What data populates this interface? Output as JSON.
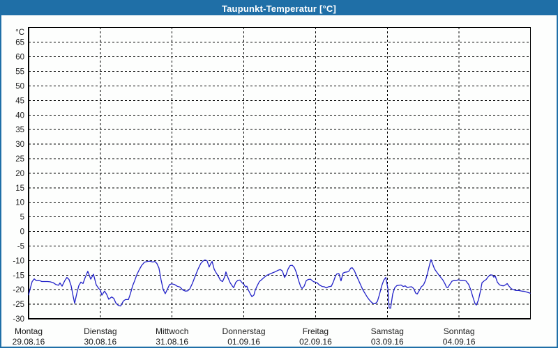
{
  "window": {
    "title": "Taupunkt-Temperatur [°C]"
  },
  "colors": {
    "titlebar_bg": "#1f6fa7",
    "frame_border": "#1f6fa7",
    "background": "#fdfefd",
    "grid": "#000000",
    "axis": "#000000",
    "label_text": "#1a1a1a",
    "line": "#2121c8"
  },
  "chart_data": {
    "type": "line",
    "title": "Taupunkt-Temperatur [°C]",
    "y_unit": "°C",
    "ylabel": "Taupunkt-Temperatur",
    "xlabel": "",
    "grid": true,
    "legend": "none",
    "ylim": [
      -30,
      70.2
    ],
    "y_ticks": [
      65,
      60,
      55,
      50,
      45,
      40,
      35,
      30,
      25,
      20,
      15,
      10,
      5,
      0,
      -5,
      -10,
      -15,
      -20,
      -25,
      -30
    ],
    "x_hours_total": 168,
    "x_days": [
      {
        "name": "Montag",
        "date": "29.08.16"
      },
      {
        "name": "Dienstag",
        "date": "30.08.16"
      },
      {
        "name": "Mittwoch",
        "date": "31.08.16"
      },
      {
        "name": "Donnerstag",
        "date": "01.09.16"
      },
      {
        "name": "Freitag",
        "date": "02.09.16"
      },
      {
        "name": "Samstag",
        "date": "03.09.16"
      },
      {
        "name": "Sonntag",
        "date": "04.09.16"
      }
    ],
    "series": [
      {
        "name": "Taupunkt",
        "color": "#2121c8",
        "points": [
          [
            0,
            -21.8
          ],
          [
            0.5,
            -19.8
          ],
          [
            1.2,
            -17.2
          ],
          [
            1.9,
            -16.3
          ],
          [
            2.6,
            -16.9
          ],
          [
            3.5,
            -16.8
          ],
          [
            4.4,
            -17.2
          ],
          [
            5.4,
            -17.2
          ],
          [
            6.3,
            -17.2
          ],
          [
            7.2,
            -17.3
          ],
          [
            8.2,
            -17.6
          ],
          [
            9.1,
            -18.2
          ],
          [
            10,
            -18.5
          ],
          [
            10.5,
            -17.7
          ],
          [
            11.2,
            -18.8
          ],
          [
            12.1,
            -16.9
          ],
          [
            12.8,
            -15.8
          ],
          [
            13.5,
            -16.5
          ],
          [
            14.2,
            -18.6
          ],
          [
            14.9,
            -22.3
          ],
          [
            15.4,
            -24.7
          ],
          [
            16.1,
            -21.4
          ],
          [
            16.8,
            -18.6
          ],
          [
            17.5,
            -17.4
          ],
          [
            18.2,
            -17.9
          ],
          [
            18.9,
            -15.9
          ],
          [
            19.8,
            -13.7
          ],
          [
            20.8,
            -16.4
          ],
          [
            21.7,
            -14.7
          ],
          [
            22.6,
            -18.3
          ],
          [
            23.3,
            -19.4
          ],
          [
            24,
            -20.2
          ],
          [
            24.5,
            -21.9
          ],
          [
            25.4,
            -20.5
          ],
          [
            26.1,
            -21.6
          ],
          [
            26.8,
            -23.3
          ],
          [
            27.8,
            -22.5
          ],
          [
            28.5,
            -23
          ],
          [
            29.2,
            -24.6
          ],
          [
            30.1,
            -25.5
          ],
          [
            30.8,
            -25.6
          ],
          [
            31.7,
            -23.9
          ],
          [
            32.4,
            -23.4
          ],
          [
            33.4,
            -23.4
          ],
          [
            34.1,
            -21.3
          ],
          [
            34.8,
            -18.7
          ],
          [
            35.5,
            -16.9
          ],
          [
            36.2,
            -14.9
          ],
          [
            36.9,
            -13.4
          ],
          [
            37.8,
            -11.7
          ],
          [
            38.7,
            -10.6
          ],
          [
            39.7,
            -10.3
          ],
          [
            40.6,
            -10.2
          ],
          [
            41.5,
            -10.5
          ],
          [
            42.2,
            -10.3
          ],
          [
            42.9,
            -11
          ],
          [
            43.6,
            -12.6
          ],
          [
            44.3,
            -16.6
          ],
          [
            45,
            -19.9
          ],
          [
            45.7,
            -21.4
          ],
          [
            46.4,
            -19.9
          ],
          [
            47.1,
            -18.3
          ],
          [
            47.8,
            -18
          ],
          [
            48.8,
            -18.2
          ],
          [
            49.7,
            -18.8
          ],
          [
            50.6,
            -19.1
          ],
          [
            51.6,
            -20.1
          ],
          [
            52.5,
            -20.5
          ],
          [
            53.2,
            -20.4
          ],
          [
            53.9,
            -19.8
          ],
          [
            54.8,
            -17.8
          ],
          [
            55.8,
            -15.2
          ],
          [
            56.7,
            -12.9
          ],
          [
            57.6,
            -11
          ],
          [
            58.3,
            -10.2
          ],
          [
            59,
            -9.8
          ],
          [
            59.7,
            -10.1
          ],
          [
            60.4,
            -12.2
          ],
          [
            60.9,
            -11.1
          ],
          [
            61.4,
            -10.3
          ],
          [
            62.1,
            -13
          ],
          [
            62.8,
            -14.3
          ],
          [
            63.5,
            -15.4
          ],
          [
            64.2,
            -16.8
          ],
          [
            64.9,
            -17.2
          ],
          [
            65.6,
            -15.6
          ],
          [
            66,
            -13.9
          ],
          [
            66.7,
            -15.9
          ],
          [
            67.4,
            -17.6
          ],
          [
            68.1,
            -18.7
          ],
          [
            68.6,
            -19.3
          ],
          [
            69.3,
            -17.5
          ],
          [
            70,
            -16.8
          ],
          [
            70.7,
            -16.7
          ],
          [
            71.4,
            -17.6
          ],
          [
            72.1,
            -18.3
          ],
          [
            72.6,
            -19.1
          ],
          [
            73,
            -18.8
          ],
          [
            73.5,
            -20.1
          ],
          [
            74.2,
            -21.5
          ],
          [
            74.7,
            -22.4
          ],
          [
            75.4,
            -21.8
          ],
          [
            75.8,
            -20.2
          ],
          [
            76.5,
            -18.6
          ],
          [
            77.2,
            -17.2
          ],
          [
            77.9,
            -16.6
          ],
          [
            78.9,
            -15.7
          ],
          [
            79.8,
            -15
          ],
          [
            80.7,
            -14.6
          ],
          [
            81.7,
            -14.2
          ],
          [
            82.6,
            -13.8
          ],
          [
            83.5,
            -13.3
          ],
          [
            84.2,
            -13.1
          ],
          [
            84.9,
            -13.6
          ],
          [
            85.6,
            -15.8
          ],
          [
            86.1,
            -15
          ],
          [
            86.8,
            -12.9
          ],
          [
            87.5,
            -11.7
          ],
          [
            88.2,
            -11.6
          ],
          [
            88.9,
            -12.4
          ],
          [
            89.6,
            -14.2
          ],
          [
            90.3,
            -16.8
          ],
          [
            91,
            -18.9
          ],
          [
            91.5,
            -19.6
          ],
          [
            92.2,
            -18.8
          ],
          [
            92.9,
            -16.9
          ],
          [
            93.6,
            -16.5
          ],
          [
            94.3,
            -16.4
          ],
          [
            95,
            -17
          ],
          [
            95.4,
            -17.3
          ],
          [
            95.9,
            -17.4
          ],
          [
            96.6,
            -17.7
          ],
          [
            97.3,
            -18.4
          ],
          [
            98.2,
            -18.9
          ],
          [
            98.9,
            -19
          ],
          [
            99.6,
            -19.4
          ],
          [
            100.3,
            -19
          ],
          [
            101.3,
            -18.8
          ],
          [
            102,
            -17.2
          ],
          [
            102.7,
            -15.2
          ],
          [
            103.1,
            -14.6
          ],
          [
            103.8,
            -14.5
          ],
          [
            104.5,
            -17
          ],
          [
            105.2,
            -14.3
          ],
          [
            105.9,
            -14
          ],
          [
            106.6,
            -13.9
          ],
          [
            107.1,
            -13.7
          ],
          [
            107.8,
            -12.6
          ],
          [
            108.3,
            -12.5
          ],
          [
            109,
            -13.5
          ],
          [
            109.7,
            -15.2
          ],
          [
            110.4,
            -16.8
          ],
          [
            111.1,
            -18.4
          ],
          [
            111.8,
            -20
          ],
          [
            112.5,
            -21.2
          ],
          [
            113.2,
            -22.4
          ],
          [
            113.9,
            -23.4
          ],
          [
            114.6,
            -24.2
          ],
          [
            115.3,
            -24.8
          ],
          [
            116,
            -24.8
          ],
          [
            116.7,
            -24
          ],
          [
            117.4,
            -21.6
          ],
          [
            118.1,
            -18.8
          ],
          [
            118.8,
            -16.8
          ],
          [
            119.5,
            -15.8
          ],
          [
            120.2,
            -19.6
          ],
          [
            120.6,
            -26.3
          ],
          [
            121.1,
            -26.4
          ],
          [
            121.8,
            -21.5
          ],
          [
            122.5,
            -19.3
          ],
          [
            123.2,
            -18.6
          ],
          [
            123.9,
            -18.5
          ],
          [
            124.6,
            -18.4
          ],
          [
            125.3,
            -18.9
          ],
          [
            126,
            -18.7
          ],
          [
            126.7,
            -19.3
          ],
          [
            127.4,
            -19.1
          ],
          [
            128.1,
            -19
          ],
          [
            128.8,
            -19.6
          ],
          [
            129.5,
            -21.2
          ],
          [
            130,
            -21.5
          ],
          [
            130.7,
            -20.3
          ],
          [
            131.4,
            -19
          ],
          [
            132.1,
            -18.4
          ],
          [
            132.8,
            -16.8
          ],
          [
            133.5,
            -14.2
          ],
          [
            134.2,
            -11.2
          ],
          [
            134.6,
            -9.7
          ],
          [
            135.1,
            -11
          ],
          [
            135.8,
            -12.9
          ],
          [
            136.5,
            -13.9
          ],
          [
            137.2,
            -14.9
          ],
          [
            137.9,
            -15.8
          ],
          [
            138.6,
            -16.7
          ],
          [
            139.3,
            -18
          ],
          [
            139.8,
            -19.2
          ],
          [
            140.2,
            -19.3
          ],
          [
            140.9,
            -18.2
          ],
          [
            141.6,
            -17.1
          ],
          [
            142.3,
            -16.8
          ],
          [
            143,
            -16.9
          ],
          [
            143.7,
            -16.6
          ],
          [
            144.4,
            -16.8
          ],
          [
            145.4,
            -16.8
          ],
          [
            146.3,
            -17
          ],
          [
            147.2,
            -18.2
          ],
          [
            147.9,
            -20
          ],
          [
            148.6,
            -22.5
          ],
          [
            149.3,
            -24.7
          ],
          [
            149.8,
            -25.3
          ],
          [
            150.5,
            -23.5
          ],
          [
            151.2,
            -20.3
          ],
          [
            151.7,
            -17.6
          ],
          [
            152.4,
            -17
          ],
          [
            153.1,
            -16.5
          ],
          [
            153.8,
            -15.5
          ],
          [
            154.5,
            -14.9
          ],
          [
            155.2,
            -15
          ],
          [
            155.6,
            -15.7
          ],
          [
            156.1,
            -15.3
          ],
          [
            156.8,
            -17.4
          ],
          [
            157.5,
            -18.3
          ],
          [
            158.2,
            -18.6
          ],
          [
            158.9,
            -18.7
          ],
          [
            159.6,
            -18.3
          ],
          [
            160.1,
            -17.9
          ],
          [
            160.8,
            -18.9
          ],
          [
            161.5,
            -19.7
          ],
          [
            162.2,
            -20
          ],
          [
            163.1,
            -20.3
          ],
          [
            164,
            -20.3
          ],
          [
            165,
            -20.5
          ],
          [
            165.9,
            -20.6
          ],
          [
            166.8,
            -20.9
          ],
          [
            167.8,
            -21.2
          ]
        ]
      }
    ]
  }
}
